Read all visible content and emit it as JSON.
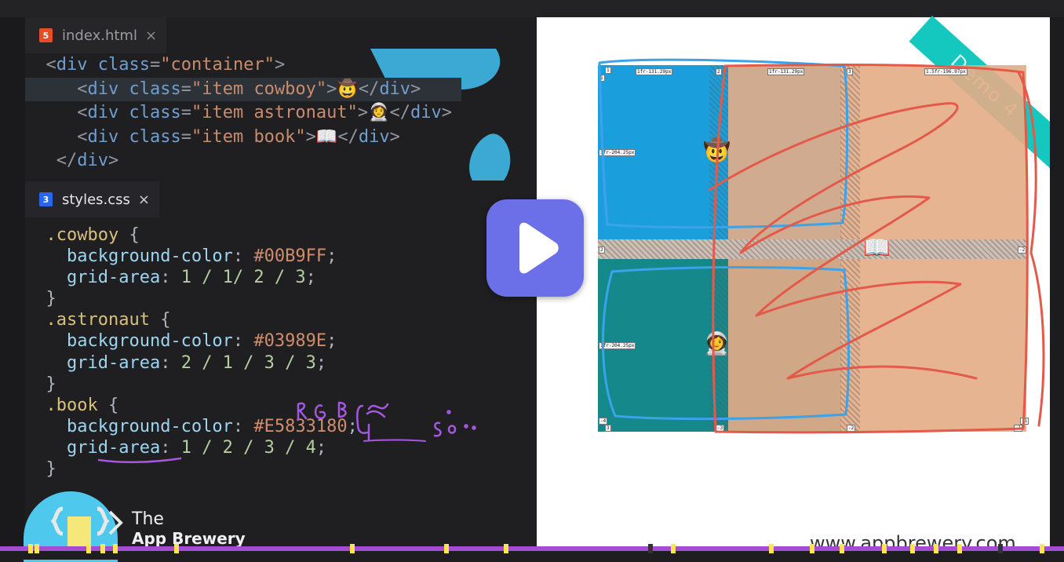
{
  "editor": {
    "html_tab": {
      "filename": "index.html",
      "icon": "html5-file-icon",
      "close": "×",
      "badge": "5"
    },
    "html_lines": [
      {
        "indent": "  ",
        "parts": [
          [
            "punc",
            "<"
          ],
          [
            "tag",
            "div"
          ],
          [
            "plain",
            " "
          ],
          [
            "tag",
            "class"
          ],
          [
            "punc",
            "="
          ],
          [
            "str",
            "\"container\""
          ],
          [
            "punc",
            ">"
          ]
        ]
      },
      {
        "indent": "     ",
        "parts": [
          [
            "punc",
            "<"
          ],
          [
            "tag",
            "div"
          ],
          [
            "plain",
            " "
          ],
          [
            "tag",
            "class"
          ],
          [
            "punc",
            "="
          ],
          [
            "str",
            "\"item cowboy\""
          ],
          [
            "punc",
            ">"
          ],
          [
            "plain",
            "🤠"
          ],
          [
            "punc",
            "</"
          ],
          [
            "tag",
            "div"
          ],
          [
            "punc",
            ">"
          ]
        ],
        "selected": true
      },
      {
        "indent": "     ",
        "parts": [
          [
            "punc",
            "<"
          ],
          [
            "tag",
            "div"
          ],
          [
            "plain",
            " "
          ],
          [
            "tag",
            "class"
          ],
          [
            "punc",
            "="
          ],
          [
            "str",
            "\"item astronaut\""
          ],
          [
            "punc",
            ">"
          ],
          [
            "plain",
            "👩‍🚀"
          ],
          [
            "punc",
            "</"
          ],
          [
            "tag",
            "div"
          ],
          [
            "punc",
            ">"
          ]
        ]
      },
      {
        "indent": "     ",
        "parts": [
          [
            "punc",
            "<"
          ],
          [
            "tag",
            "div"
          ],
          [
            "plain",
            " "
          ],
          [
            "tag",
            "class"
          ],
          [
            "punc",
            "="
          ],
          [
            "str",
            "\"item book\""
          ],
          [
            "punc",
            ">"
          ],
          [
            "plain",
            "📖"
          ],
          [
            "punc",
            "</"
          ],
          [
            "tag",
            "div"
          ],
          [
            "punc",
            ">"
          ]
        ]
      },
      {
        "indent": "   ",
        "parts": [
          [
            "punc",
            "</"
          ],
          [
            "tag",
            "div"
          ],
          [
            "punc",
            ">"
          ]
        ]
      }
    ],
    "css_tab": {
      "filename": "styles.css",
      "icon": "css3-file-icon",
      "close": "×",
      "badge": "3"
    },
    "css_lines": [
      {
        "indent": "  ",
        "parts": [
          [
            "sel",
            ".cowboy"
          ],
          [
            "plain",
            " {"
          ]
        ]
      },
      {
        "indent": "    ",
        "parts": [
          [
            "prop",
            "background-color"
          ],
          [
            "plain",
            ": "
          ],
          [
            "hex",
            "#00B9FF"
          ],
          [
            "plain",
            ";"
          ]
        ]
      },
      {
        "indent": "    ",
        "parts": [
          [
            "prop",
            "grid-area"
          ],
          [
            "plain",
            ": "
          ],
          [
            "val",
            "1 / 1/ 2 / 3"
          ],
          [
            "plain",
            ";"
          ]
        ]
      },
      {
        "indent": "  ",
        "parts": [
          [
            "plain",
            "}"
          ]
        ]
      },
      {
        "indent": "  ",
        "parts": [
          [
            "sel",
            ".astronaut"
          ],
          [
            "plain",
            " {"
          ]
        ]
      },
      {
        "indent": "    ",
        "parts": [
          [
            "prop",
            "background-color"
          ],
          [
            "plain",
            ": "
          ],
          [
            "hex",
            "#03989E"
          ],
          [
            "plain",
            ";"
          ]
        ]
      },
      {
        "indent": "    ",
        "parts": [
          [
            "prop",
            "grid-area"
          ],
          [
            "plain",
            ": "
          ],
          [
            "val",
            "2 / 1 / 3 / 3"
          ],
          [
            "plain",
            ";"
          ]
        ]
      },
      {
        "indent": "  ",
        "parts": [
          [
            "plain",
            "}"
          ]
        ]
      },
      {
        "indent": "  ",
        "parts": [
          [
            "sel",
            ".book"
          ],
          [
            "plain",
            " {"
          ]
        ]
      },
      {
        "indent": "    ",
        "parts": [
          [
            "prop",
            "background-color"
          ],
          [
            "plain",
            ": "
          ],
          [
            "hex",
            "#E5833180"
          ],
          [
            "plain",
            "; "
          ]
        ]
      },
      {
        "indent": "    ",
        "parts": [
          [
            "prop",
            "grid-area"
          ],
          [
            "plain",
            ": "
          ],
          [
            "val",
            "1 / 2 / 3 / 4"
          ],
          [
            "plain",
            ";"
          ]
        ]
      },
      {
        "indent": "  ",
        "parts": [
          [
            "plain",
            "}"
          ]
        ]
      }
    ],
    "annotation": "RGB ∝ 50%",
    "colors": {
      "tag": "#6f9fd1",
      "string": "#c98c6d",
      "selector": "#d9c07a",
      "property": "#9cd5f0"
    }
  },
  "player": {
    "play_icon": "play-icon",
    "accent": "#6b6fe8",
    "progress_color": "#a64bd6",
    "marker_color": "#ffe650"
  },
  "preview": {
    "ribbon": "Demo 4",
    "ribbon_color": "#14c8c0",
    "grid_labels": {
      "line_1": "1",
      "line_2": "2",
      "line_3": "3",
      "col1": "1fr-131.29px",
      "col2": "1fr-131.29px",
      "col3": "1.5fr-196.97px",
      "row1": "1fr-204.25px",
      "row2": "1fr-204.25px",
      "neg1": "-1",
      "neg2": "-2",
      "neg3": "-3",
      "neg4": "-4"
    },
    "cells": [
      {
        "name": "cowboy",
        "color": "#00B9FF",
        "emoji": "🤠"
      },
      {
        "name": "astronaut",
        "color": "#03989E",
        "emoji": "👩‍🚀"
      },
      {
        "name": "book",
        "color": "#E5833180",
        "emoji": "📖"
      }
    ]
  },
  "branding": {
    "logo_line1": "The",
    "logo_line2": "App Brewery",
    "watermark": "www.appbrewery.com"
  }
}
